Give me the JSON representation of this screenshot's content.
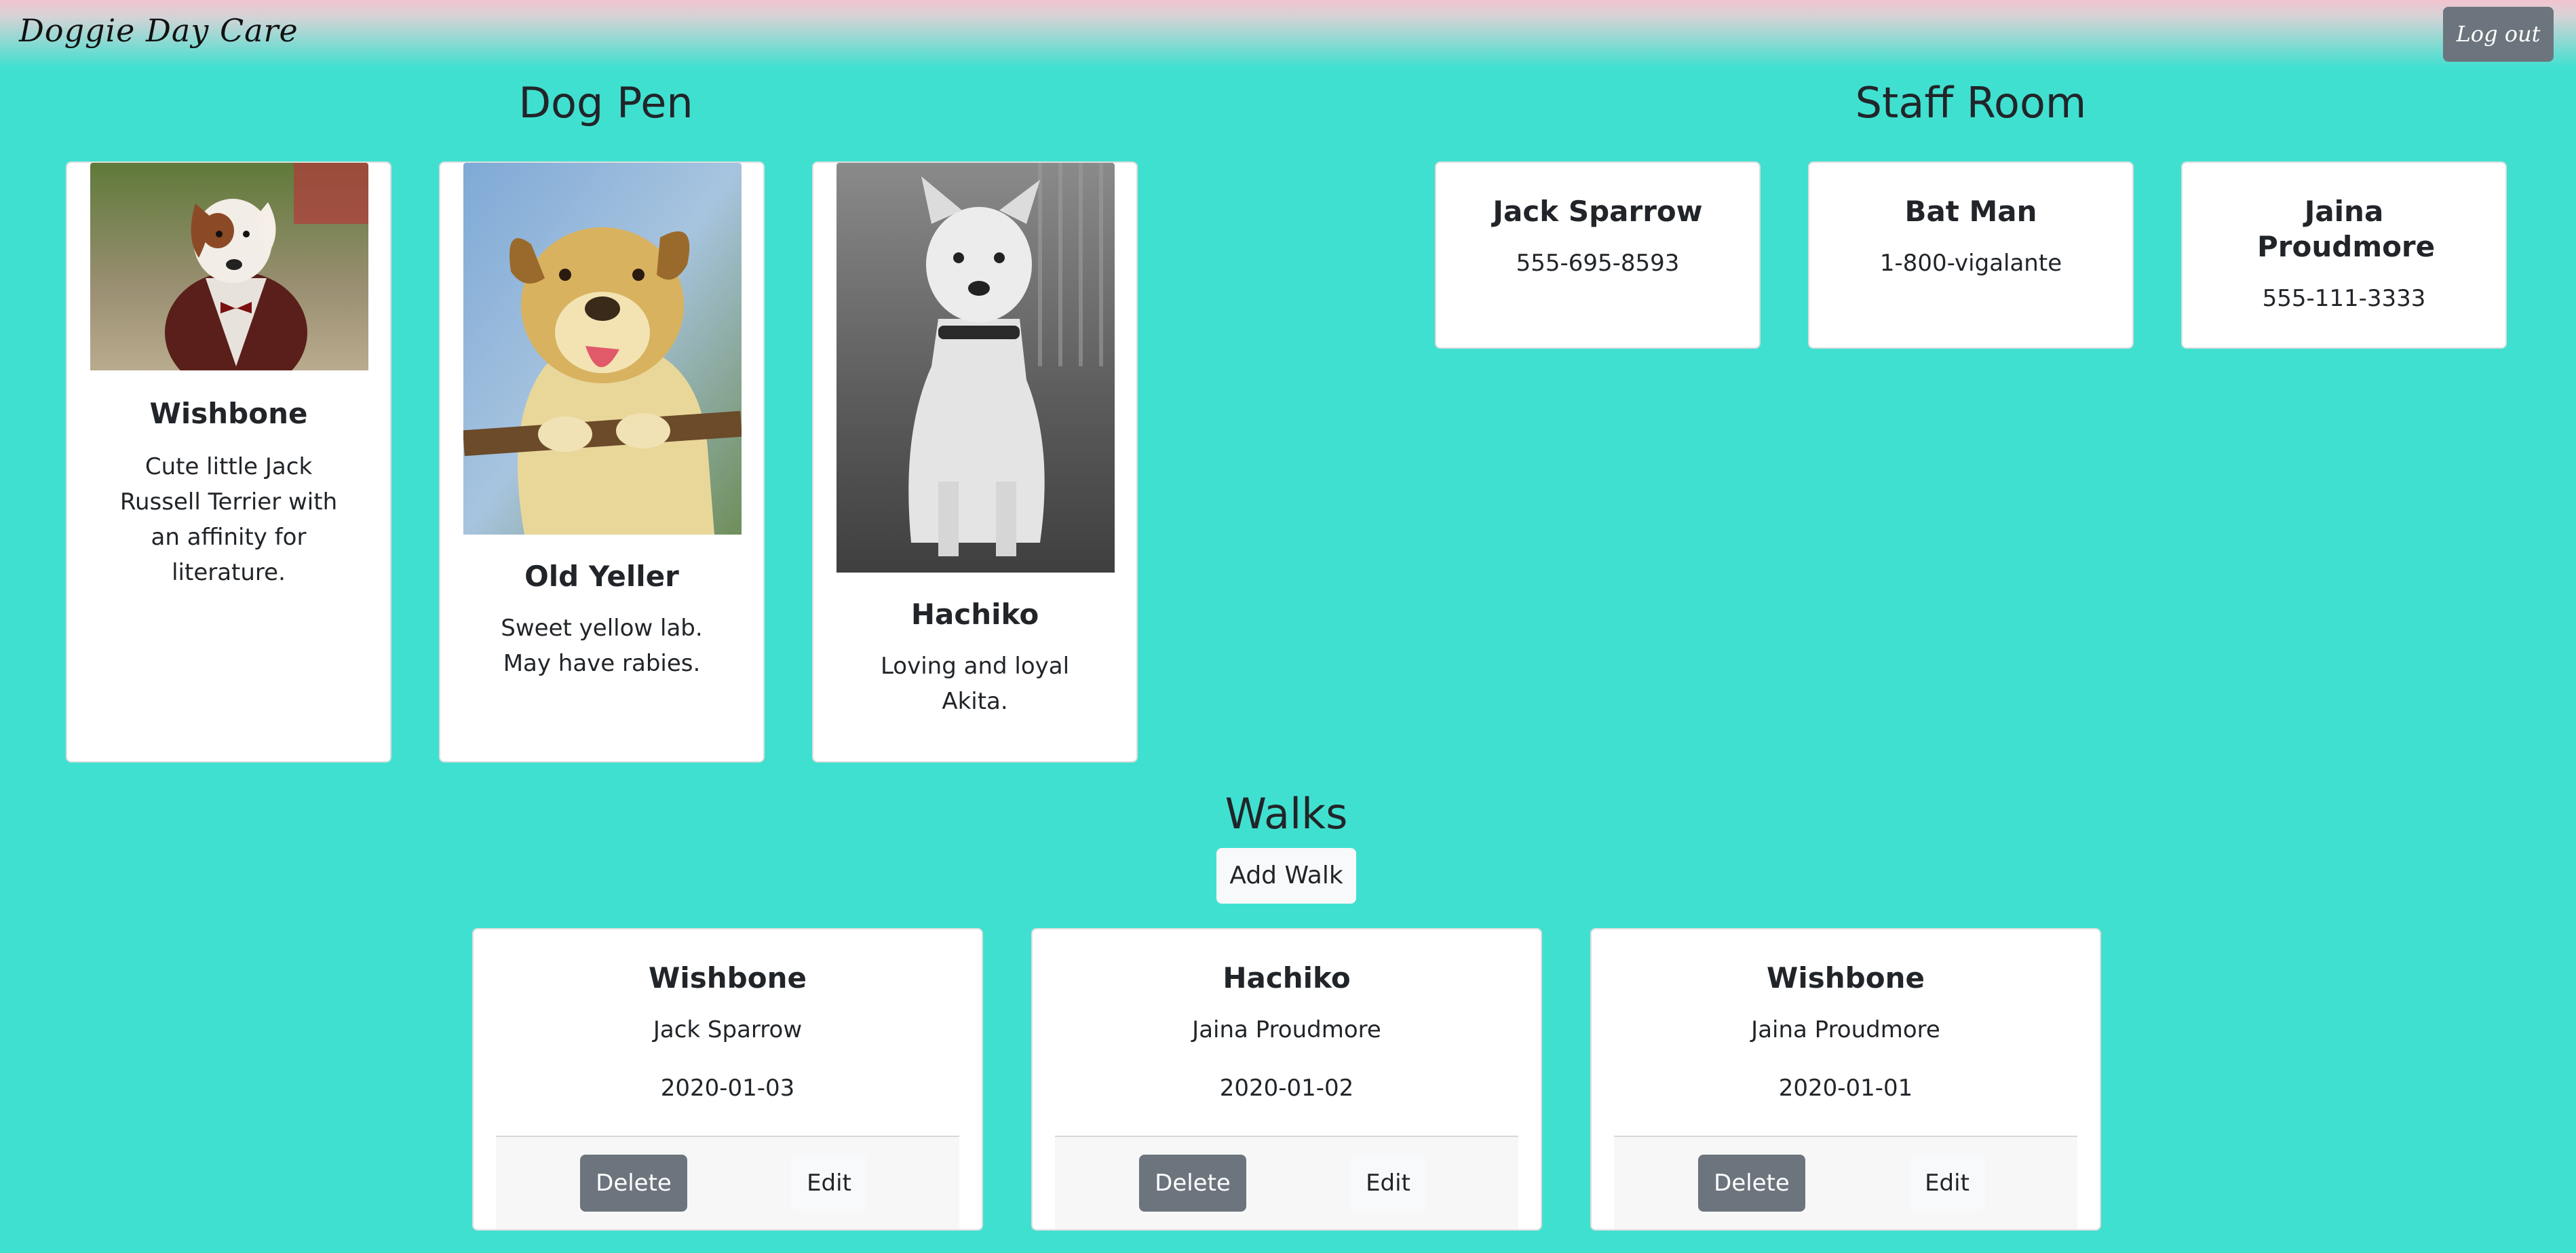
{
  "navbar": {
    "brand": "Doggie Day Care",
    "logout_label": "Log out"
  },
  "dog_pen": {
    "title": "Dog Pen",
    "dogs": [
      {
        "name": "Wishbone",
        "description": "Cute little Jack Russell Terrier with an affinity for literature."
      },
      {
        "name": "Old Yeller",
        "description": "Sweet yellow lab. May have rabies."
      },
      {
        "name": "Hachiko",
        "description": "Loving and loyal Akita."
      }
    ]
  },
  "staff_room": {
    "title": "Staff Room",
    "staff": [
      {
        "name": "Jack Sparrow",
        "phone": "555-695-8593"
      },
      {
        "name": "Bat Man",
        "phone": "1-800-vigalante"
      },
      {
        "name": "Jaina Proudmore",
        "phone": "555-111-3333"
      }
    ]
  },
  "walks": {
    "title": "Walks",
    "add_label": "Add Walk",
    "delete_label": "Delete",
    "edit_label": "Edit",
    "items": [
      {
        "dog": "Wishbone",
        "walker": "Jack Sparrow",
        "date": "2020-01-03"
      },
      {
        "dog": "Hachiko",
        "walker": "Jaina Proudmore",
        "date": "2020-01-02"
      },
      {
        "dog": "Wishbone",
        "walker": "Jaina Proudmore",
        "date": "2020-01-01"
      }
    ]
  },
  "colors": {
    "background": "#40e0d0",
    "secondary_button": "#6c757d",
    "light_button": "#f8f9fa"
  }
}
